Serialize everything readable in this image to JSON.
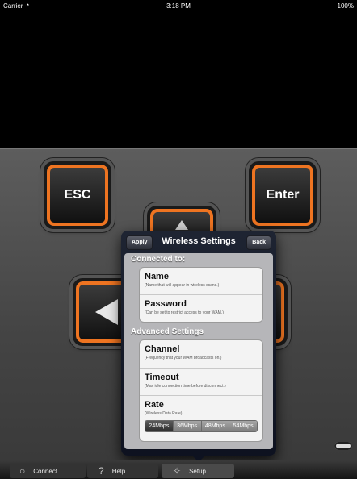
{
  "status_bar": {
    "carrier": "Carrier",
    "wifi_icon": "◔",
    "time": "3:18 PM",
    "battery": "100%"
  },
  "keypad": {
    "esc_label": "ESC",
    "enter_label": "Enter",
    "accent_color": "#ee7421"
  },
  "popover": {
    "title": "Wireless Settings",
    "apply_label": "Apply",
    "back_label": "Back",
    "section1_title": "Connected to:",
    "section2_title": "Advanced Settings",
    "rows1": [
      {
        "title": "Name",
        "subtitle": "(Name that will appear in wireless scans.)"
      },
      {
        "title": "Password",
        "subtitle": "(Can be set to restrict access to your WAM.)"
      }
    ],
    "rows2": [
      {
        "title": "Channel",
        "subtitle": "(Frequency that your WAM broadcasts on.)"
      },
      {
        "title": "Timeout",
        "subtitle": "(Max idle connection time before disconnect.)"
      },
      {
        "title": "Rate",
        "subtitle": "(Wireless Data Rate)"
      }
    ],
    "rate_options": [
      "24Mbps",
      "36Mbps",
      "48Mbps",
      "54Mbps"
    ],
    "rate_selected": "24Mbps"
  },
  "tabbar": {
    "connect_label": "Connect",
    "help_label": "Help",
    "setup_label": "Setup",
    "connect_icon": "○",
    "help_icon": "?",
    "setup_icon": "✧"
  }
}
